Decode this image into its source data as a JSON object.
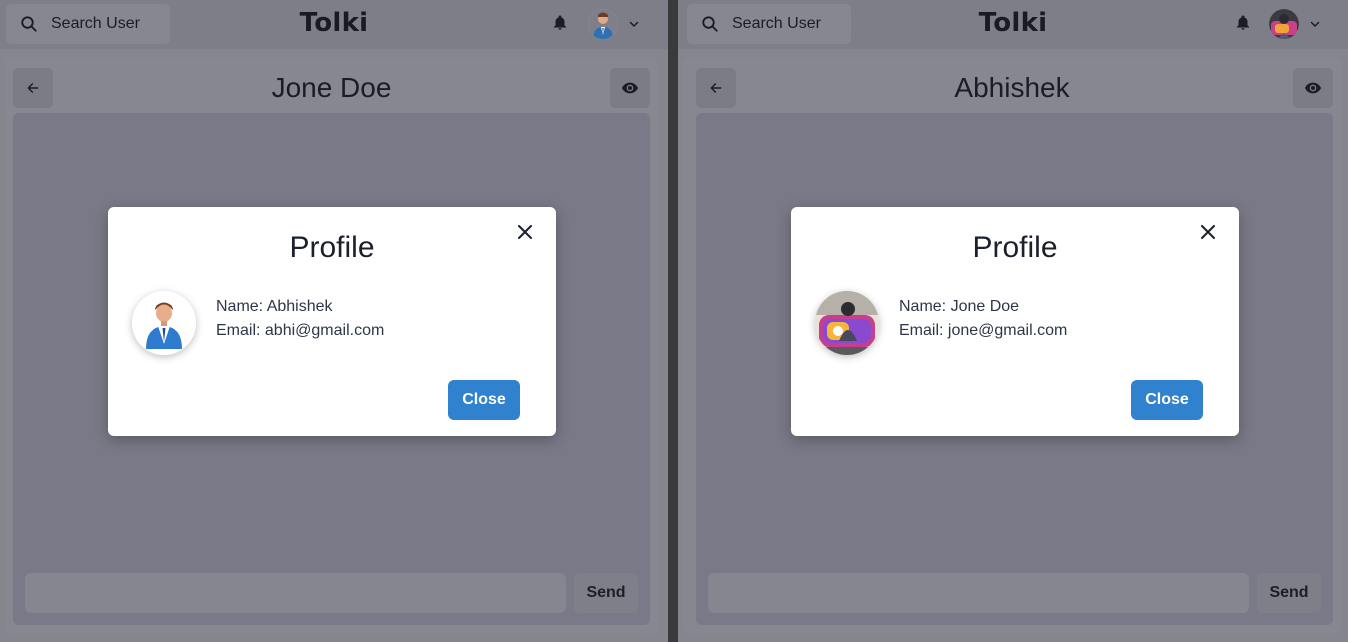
{
  "panes": [
    {
      "search_label": "Search User",
      "app_title": "Tolki",
      "chat_title": "Jone Doe",
      "send_label": "Send",
      "message_placeholder": "",
      "modal": {
        "title": "Profile",
        "name_line": "Name: Abhishek",
        "email_line": "Email: abhi@gmail.com",
        "close_label": "Close"
      }
    },
    {
      "search_label": "Search User",
      "app_title": "Tolki",
      "chat_title": "Abhishek",
      "send_label": "Send",
      "message_placeholder": "",
      "modal": {
        "title": "Profile",
        "name_line": "Name: Jone Doe",
        "email_line": "Email: jone@gmail.com",
        "close_label": "Close"
      }
    }
  ],
  "icons": {
    "search": "search-icon",
    "bell": "bell-icon",
    "chevron": "chevron-down-icon",
    "back": "arrow-left-icon",
    "eye": "eye-icon",
    "close": "close-icon"
  },
  "colors": {
    "accent": "#3182ce",
    "overlay": "#85858e",
    "modal_bg": "#ffffff"
  }
}
